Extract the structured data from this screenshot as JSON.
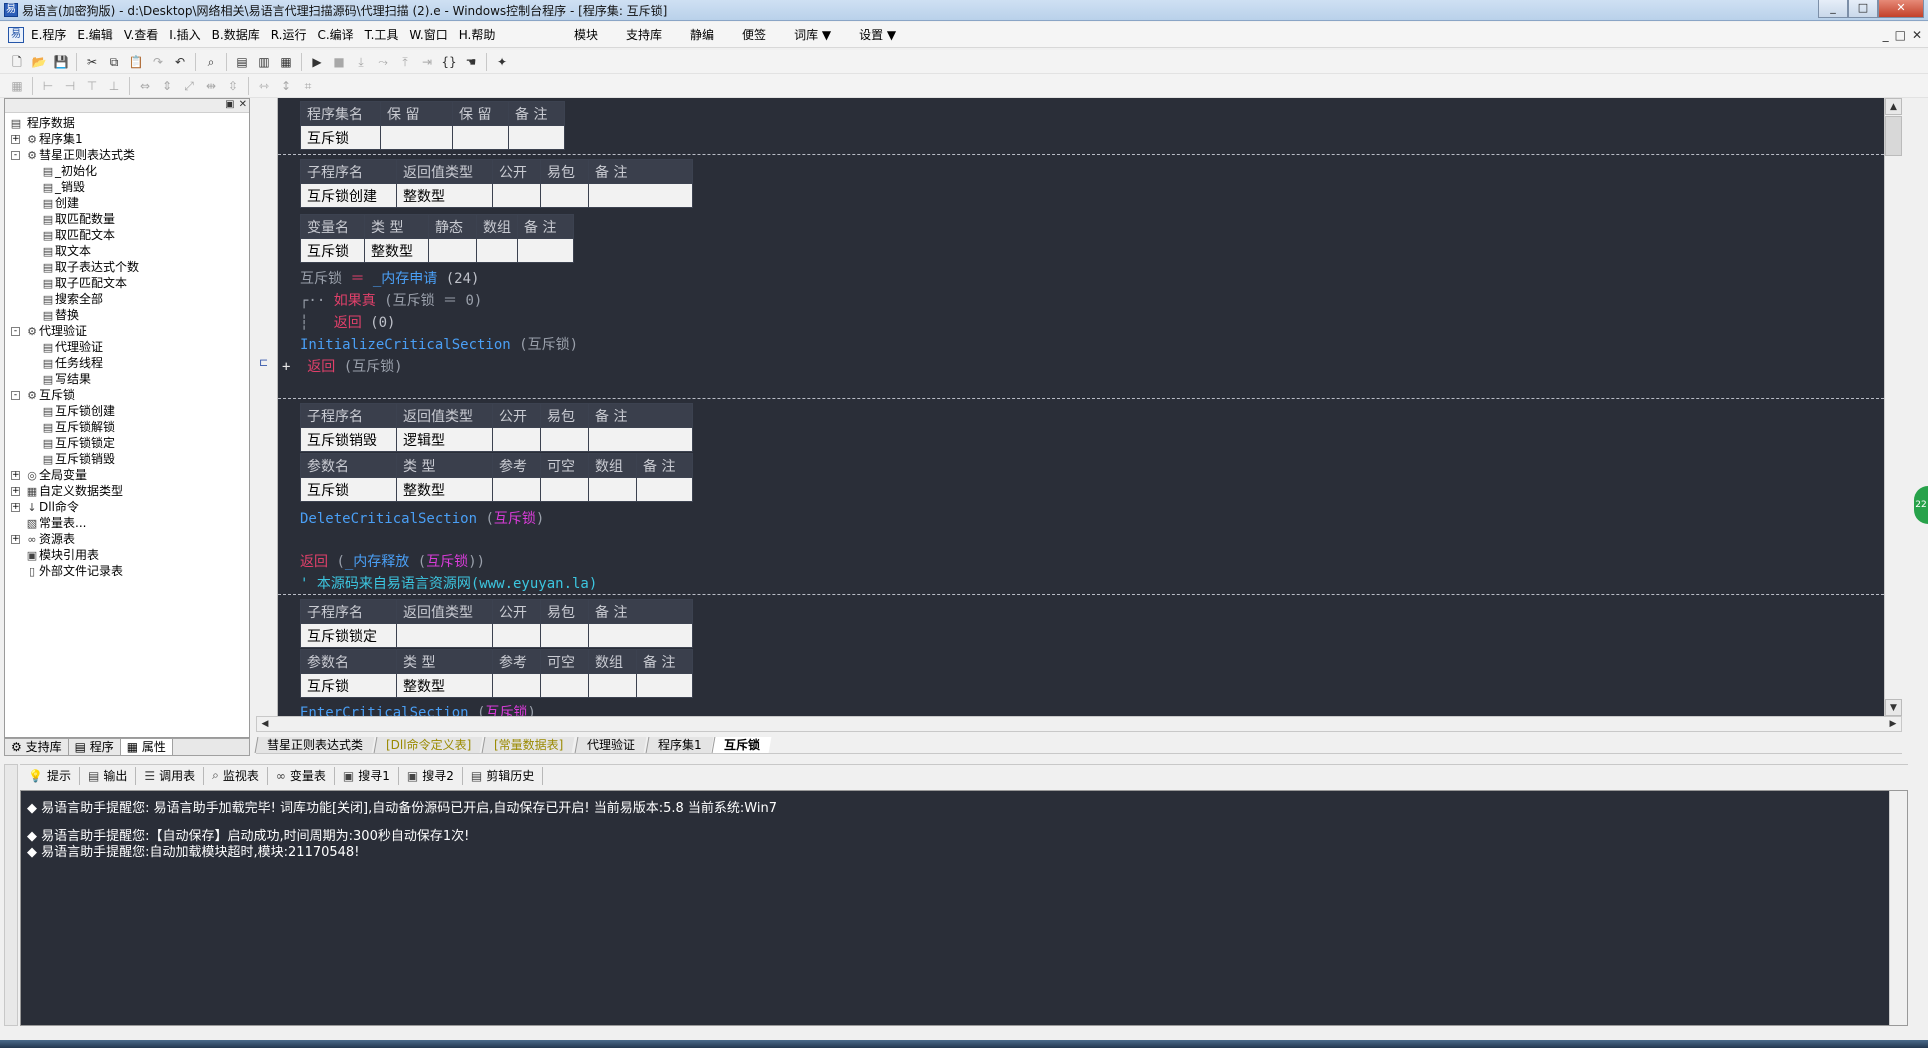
{
  "window": {
    "title": "易语言(加密狗版) - d:\\Desktop\\网络相关\\易语言代理扫描源码\\代理扫描 (2).e - Windows控制台程序 - [程序集: 互斥锁]",
    "buttons": [
      "_",
      "□",
      "✕"
    ]
  },
  "menu": {
    "items": [
      "E.程序",
      "E.编辑",
      "V.查看",
      "I.插入",
      "B.数据库",
      "R.运行",
      "C.编译",
      "T.工具",
      "W.窗口",
      "H.帮助"
    ],
    "right_items": [
      "模块",
      "支持库",
      "静编",
      "便签",
      "词库 ▼",
      "设置 ▼"
    ],
    "mdi": [
      "_",
      "□",
      "✕"
    ]
  },
  "left_panel": {
    "root": "程序数据",
    "tree": [
      {
        "label": "程序集1",
        "level": 1,
        "icon": "gear-icon",
        "exp": "+"
      },
      {
        "label": "彗星正则表达式类",
        "level": 1,
        "icon": "gear-icon",
        "exp": "-"
      },
      {
        "label": "_初始化",
        "level": 2,
        "icon": "sub-icon"
      },
      {
        "label": "_销毁",
        "level": 2,
        "icon": "sub-icon"
      },
      {
        "label": "创建",
        "level": 2,
        "icon": "sub-icon"
      },
      {
        "label": "取匹配数量",
        "level": 2,
        "icon": "sub-icon"
      },
      {
        "label": "取匹配文本",
        "level": 2,
        "icon": "sub-icon"
      },
      {
        "label": "取文本",
        "level": 2,
        "icon": "sub-icon"
      },
      {
        "label": "取子表达式个数",
        "level": 2,
        "icon": "sub-icon"
      },
      {
        "label": "取子匹配文本",
        "level": 2,
        "icon": "sub-icon"
      },
      {
        "label": "搜索全部",
        "level": 2,
        "icon": "sub-icon"
      },
      {
        "label": "替换",
        "level": 2,
        "icon": "sub-icon"
      },
      {
        "label": "代理验证",
        "level": 1,
        "icon": "gear-icon",
        "exp": "-"
      },
      {
        "label": "代理验证",
        "level": 2,
        "icon": "sub-icon"
      },
      {
        "label": "任务线程",
        "level": 2,
        "icon": "sub-icon"
      },
      {
        "label": "写结果",
        "level": 2,
        "icon": "sub-icon"
      },
      {
        "label": "互斥锁",
        "level": 1,
        "icon": "gear-icon",
        "exp": "-"
      },
      {
        "label": "互斥锁创建",
        "level": 2,
        "icon": "sub-icon"
      },
      {
        "label": "互斥锁解锁",
        "level": 2,
        "icon": "sub-icon"
      },
      {
        "label": "互斥锁锁定",
        "level": 2,
        "icon": "sub-icon"
      },
      {
        "label": "互斥锁销毁",
        "level": 2,
        "icon": "sub-icon"
      },
      {
        "label": "全局变量",
        "level": 1,
        "icon": "globe-icon",
        "exp": "+"
      },
      {
        "label": "自定义数据类型",
        "level": 1,
        "icon": "type-icon",
        "exp": "+"
      },
      {
        "label": "Dll命令",
        "level": 1,
        "icon": "dll-icon",
        "exp": "+"
      },
      {
        "label": "常量表...",
        "level": 1,
        "icon": "const-icon"
      },
      {
        "label": "资源表",
        "level": 1,
        "icon": "res-icon",
        "exp": "+"
      },
      {
        "label": "模块引用表",
        "level": 1,
        "icon": "module-icon"
      },
      {
        "label": "外部文件记录表",
        "level": 1,
        "icon": "file-icon"
      }
    ],
    "tabs": [
      "支持库",
      "程序",
      "属性"
    ]
  },
  "editor": {
    "assembly_table": {
      "headers": [
        "程序集名",
        "保 留",
        "保 留",
        "备 注"
      ],
      "values": [
        "互斥锁",
        "",
        "",
        ""
      ]
    },
    "sub1": {
      "headers": [
        "子程序名",
        "返回值类型",
        "公开",
        "易包",
        "备 注"
      ],
      "values": [
        "互斥锁创建",
        "整数型",
        "",
        "",
        ""
      ],
      "var_headers": [
        "变量名",
        "类 型",
        "静态",
        "数组",
        "备 注"
      ],
      "var_values": [
        "互斥锁",
        "整数型",
        "",
        "",
        ""
      ]
    },
    "code1": {
      "l1_var": "互斥锁",
      "l1_eq": "＝",
      "l1_fn": "_内存申请",
      "l1_arg": "(24)",
      "l2_kw": "如果真",
      "l2_arg": "(互斥锁 ＝ 0)",
      "l3_kw": "返回",
      "l3_arg": "(0)",
      "l4_fn": "InitializeCriticalSection",
      "l4_arg": "(互斥锁)",
      "l5_kw": "返回",
      "l5_arg": "(互斥锁)"
    },
    "sub2": {
      "headers": [
        "子程序名",
        "返回值类型",
        "公开",
        "易包",
        "备 注"
      ],
      "values": [
        "互斥锁销毁",
        "逻辑型",
        "",
        "",
        ""
      ],
      "param_headers": [
        "参数名",
        "类 型",
        "参考",
        "可空",
        "数组",
        "备 注"
      ],
      "param_values": [
        "互斥锁",
        "整数型",
        "",
        "",
        "",
        ""
      ]
    },
    "code2": {
      "l1_fn": "DeleteCriticalSection",
      "l1_open": "(",
      "l1_arg": "互斥锁",
      "l1_close": ")",
      "l2_kw": "返回",
      "l2_open": "(",
      "l2_fn": "_内存释放",
      "l2_open2": "(",
      "l2_arg": "互斥锁",
      "l2_close": "))",
      "l3_comment": "' 本源码来自易语言资源网(www.eyuyan.la)"
    },
    "sub3": {
      "headers": [
        "子程序名",
        "返回值类型",
        "公开",
        "易包",
        "备 注"
      ],
      "values": [
        "互斥锁锁定",
        "",
        "",
        "",
        ""
      ],
      "param_headers": [
        "参数名",
        "类 型",
        "参考",
        "可空",
        "数组",
        "备 注"
      ],
      "param_values": [
        "互斥锁",
        "整数型",
        "",
        "",
        "",
        ""
      ]
    },
    "code3": {
      "l1_fn": "EnterCriticalSection",
      "l1_open": "(",
      "l1_arg": "互斥锁",
      "l1_close": ")"
    }
  },
  "editor_tabs": [
    "彗星正则表达式类",
    "[Dll命令定义表]",
    "[常量数据表]",
    "代理验证",
    "程序集1",
    "互斥锁"
  ],
  "output_tabs": [
    "提示",
    "输出",
    "调用表",
    "监视表",
    "变量表",
    "搜寻1",
    "搜寻2",
    "剪辑历史"
  ],
  "output_lines": [
    "◆ 易语言助手提醒您:  易语言助手加载完毕!  词库功能[关闭],自动备份源码已开启,自动保存已开启!  当前易版本:5.8  当前系统:Win7",
    "◆ 易语言助手提醒您:【自动保存】启动成功,时间周期为:300秒自动保存1次!",
    "◆ 易语言助手提醒您:自动加载模块超时,模块:21170548!"
  ],
  "colors": {
    "editor_bg": "#2a2e38",
    "keyword_red": "#e0406a",
    "function_blue": "#4a9ff5",
    "arg_magenta": "#d83cd8",
    "comment_cyan": "#3cc6e0"
  }
}
